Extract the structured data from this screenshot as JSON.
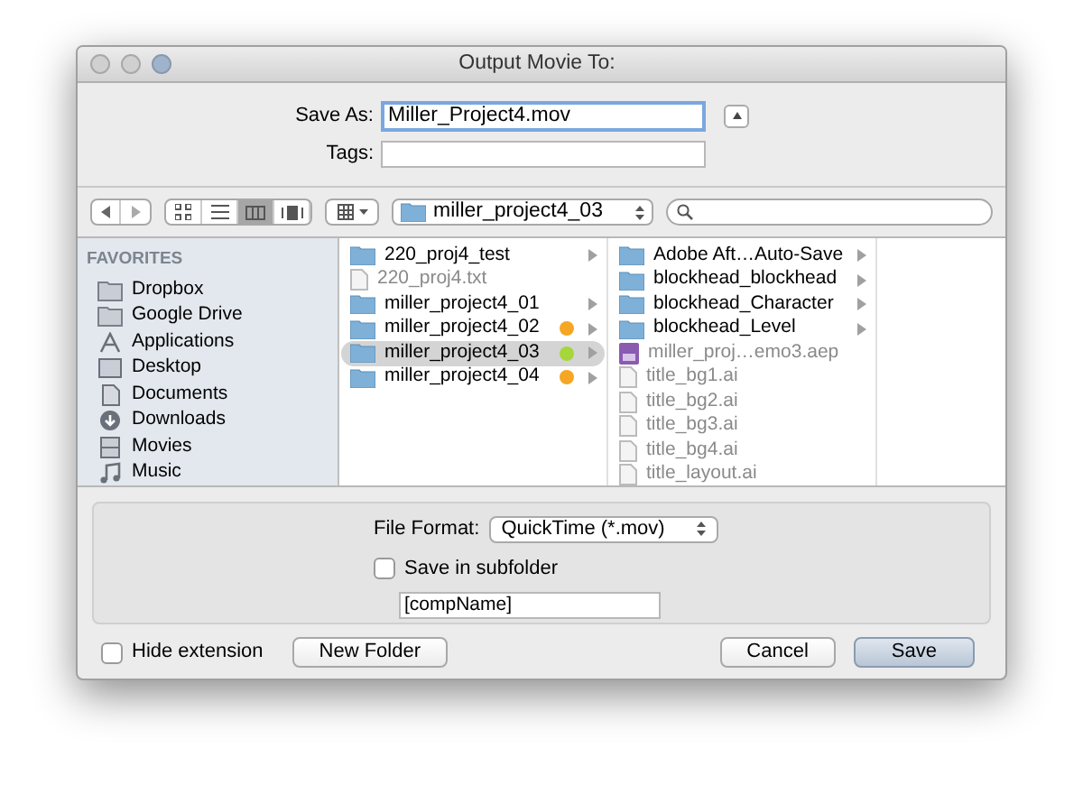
{
  "window": {
    "title": "Output Movie To:"
  },
  "save_as": {
    "label": "Save As:",
    "value": "Miller_Project4.mov",
    "expanded": false
  },
  "tags": {
    "label": "Tags:"
  },
  "toolbar": {
    "views": [
      {
        "kind": "icons",
        "selected": false
      },
      {
        "kind": "list",
        "selected": false
      },
      {
        "kind": "columns",
        "selected": true
      },
      {
        "kind": "coverflow",
        "selected": false
      }
    ],
    "location": "miller_project4_03"
  },
  "sidebar": {
    "heading": "FAVORITES",
    "items": [
      {
        "label": "Dropbox",
        "kind": "folder"
      },
      {
        "label": "Google Drive",
        "kind": "folder"
      },
      {
        "label": "Applications",
        "kind": "apps"
      },
      {
        "label": "Desktop",
        "kind": "desktop"
      },
      {
        "label": "Documents",
        "kind": "documents"
      },
      {
        "label": "Downloads",
        "kind": "downloads"
      },
      {
        "label": "Movies",
        "kind": "movies"
      },
      {
        "label": "Music",
        "kind": "music"
      }
    ]
  },
  "columns": [
    [
      {
        "name": "220_proj4_test",
        "kind": "folder",
        "selected": false
      },
      {
        "name": "220_proj4.txt",
        "kind": "file",
        "selected": false
      },
      {
        "name": "miller_project4_01",
        "kind": "folder",
        "selected": false
      },
      {
        "name": "miller_project4_02",
        "kind": "folder",
        "selected": false,
        "color": "#f5a623"
      },
      {
        "name": "miller_project4_03",
        "kind": "folder",
        "selected": true,
        "color": "#a6d63a"
      },
      {
        "name": "miller_project4_04",
        "kind": "folder",
        "selected": false,
        "color": "#f5a623"
      }
    ],
    [
      {
        "name": "Adobe Aft…Auto-Save",
        "kind": "folder",
        "selected": false
      },
      {
        "name": "blockhead_blockhead",
        "kind": "folder",
        "selected": false
      },
      {
        "name": "blockhead_Character",
        "kind": "folder",
        "selected": false
      },
      {
        "name": "blockhead_Level",
        "kind": "folder",
        "selected": false
      },
      {
        "name": "miller_proj…emo3.aep",
        "kind": "aep",
        "selected": false
      },
      {
        "name": "title_bg1.ai",
        "kind": "file",
        "selected": false
      },
      {
        "name": "title_bg2.ai",
        "kind": "file",
        "selected": false
      },
      {
        "name": "title_bg3.ai",
        "kind": "file",
        "selected": false
      },
      {
        "name": "title_bg4.ai",
        "kind": "file",
        "selected": false
      },
      {
        "name": "title_layout.ai",
        "kind": "file",
        "selected": false
      }
    ]
  ],
  "options": {
    "format_label": "File Format:",
    "format_value": "QuickTime (*.mov)",
    "subfolder": {
      "label": "Save in subfolder",
      "checked": false
    },
    "subfolder_name": "[compName]"
  },
  "footer": {
    "hide_extension": {
      "label": "Hide extension",
      "checked": false
    },
    "new_folder": "New Folder",
    "cancel": "Cancel",
    "save": "Save"
  }
}
